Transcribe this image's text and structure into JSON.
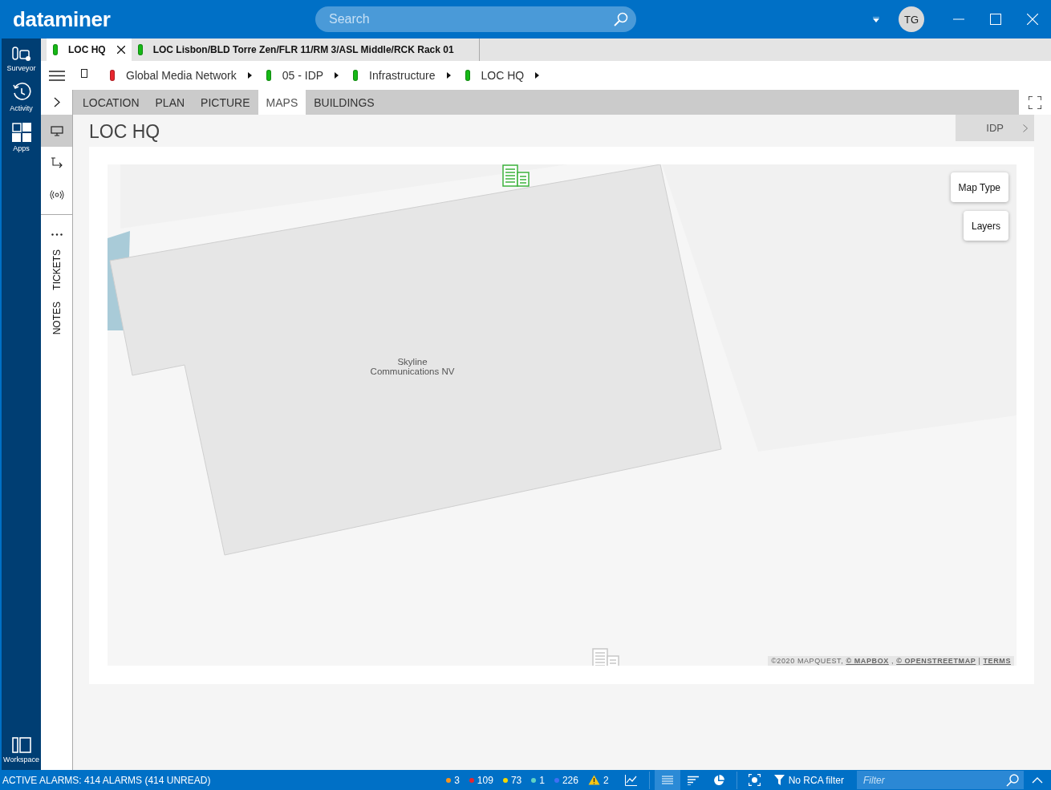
{
  "app": {
    "logo": "dataminer",
    "search": {
      "placeholder": "Search"
    },
    "avatar": "TG"
  },
  "nav": {
    "items": [
      {
        "label": "Surveyor",
        "kind": "surveyor"
      },
      {
        "label": "Activity",
        "kind": "activity"
      },
      {
        "label": "Apps",
        "kind": "apps"
      }
    ],
    "workspace": "Workspace"
  },
  "doc_tabs": [
    {
      "label": "LOC HQ",
      "selected": true,
      "color": "#16b916"
    },
    {
      "label": "LOC Lisbon/BLD Torre Zen/FLR 11/RM 3/ASL Middle/RCK Rack 01",
      "selected": false,
      "color": "#16b916"
    }
  ],
  "breadcrumb": [
    {
      "label": "Global Media Network",
      "color": "#e8262e"
    },
    {
      "label": "05 - IDP",
      "color": "#16b916"
    },
    {
      "label": "Infrastructure",
      "color": "#16b916"
    },
    {
      "label": "LOC HQ",
      "color": "#16b916"
    }
  ],
  "side_tools": [
    {
      "kind": "monitor",
      "selected": true
    },
    {
      "kind": "connections",
      "selected": false
    },
    {
      "kind": "signal",
      "selected": false
    }
  ],
  "side_panels": [
    "TICKETS",
    "NOTES"
  ],
  "sub_tabs": [
    {
      "label": "LOCATION",
      "selected": false
    },
    {
      "label": "PLAN",
      "selected": false
    },
    {
      "label": "PICTURE",
      "selected": false
    },
    {
      "label": "MAPS",
      "selected": true
    },
    {
      "label": "BUILDINGS",
      "selected": false
    }
  ],
  "page": {
    "title": "LOC HQ",
    "next_button": "IDP"
  },
  "map": {
    "place_label": "Skyline Communications NV",
    "buttons": [
      "Map Type",
      "Layers"
    ],
    "attribution": [
      {
        "kind": "text",
        "text": "©2020 MAPQUEST,"
      },
      {
        "kind": "link",
        "text": "© MAPBOX"
      },
      {
        "kind": "text",
        "text": ","
      },
      {
        "kind": "link",
        "text": "© OPENSTREETMAP"
      },
      {
        "kind": "text",
        "text": "|"
      },
      {
        "kind": "link",
        "text": "TERMS"
      }
    ]
  },
  "status_bar": {
    "alarms_text": "ACTIVE ALARMS: 414 ALARMS (414 UNREAD)",
    "counters": [
      {
        "count": "3",
        "color": "#f7941d"
      },
      {
        "count": "109",
        "color": "#e8262e"
      },
      {
        "count": "73",
        "color": "#f5d800"
      },
      {
        "count": "1",
        "color": "#5fd3c4"
      },
      {
        "count": "226",
        "color": "#3f6ff5"
      }
    ],
    "warnings": "2",
    "views": [
      {
        "kind": "list",
        "selected": true
      },
      {
        "kind": "sort",
        "selected": false
      },
      {
        "kind": "pie",
        "selected": false
      }
    ],
    "rca": "No RCA filter",
    "filter": {
      "placeholder": "Filter"
    }
  }
}
